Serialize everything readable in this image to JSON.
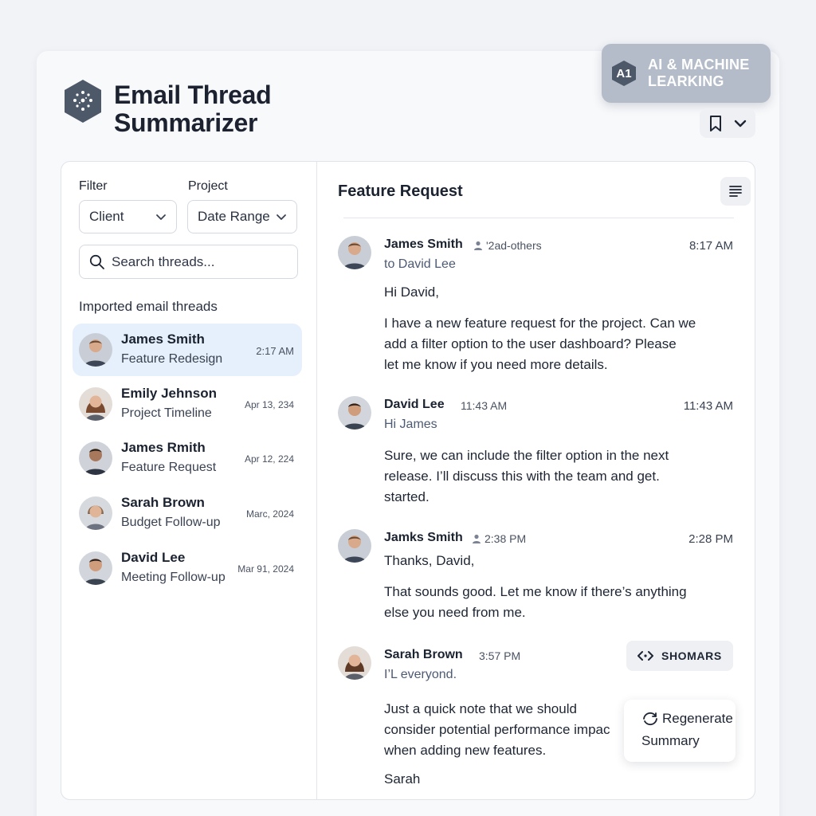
{
  "app": {
    "title": "Email Thread Summarizer"
  },
  "badge": {
    "code": "A1",
    "line1": "AI & MACHINE",
    "line2": "LEARKING"
  },
  "sidebar": {
    "filter_label": "Filter",
    "project_label": "Project",
    "filter_value": "Client",
    "project_value": "Date Range",
    "search_placeholder": "Search threads...",
    "section_title": "Imported email threads",
    "threads": [
      {
        "name": "James Smith",
        "subject": "Feature Redesign",
        "date": "2:17 AM"
      },
      {
        "name": "Emily Jehnson",
        "subject": "Project Timeline",
        "date": "Apr 13, 234"
      },
      {
        "name": "James Rmith",
        "subject": "Feature Request",
        "date": "Apr 12, 224"
      },
      {
        "name": "Sarah Brown",
        "subject": "Budget Follow-up",
        "date": "Marc, 2024"
      },
      {
        "name": "David Lee",
        "subject": "Meeting Follow-up",
        "date": "Mar 91, 2024"
      }
    ]
  },
  "main": {
    "title": "Feature Request",
    "messages": [
      {
        "from": "James Smith",
        "meta": "'2ad-others",
        "time": "8:17 AM",
        "sub": "to David Lee",
        "greeting": "Hi David,",
        "body": [
          "I have a new feature request for the project. Can we",
          "add a filter option to the user dashboard? Please",
          "let me know if you need more details."
        ]
      },
      {
        "from": "David Lee",
        "meta": "11:43 AM",
        "time": "11:43 AM",
        "sub": "Hi James",
        "body": [
          "Sure, we can include the filter option in the next",
          "release. I’ll discuss this with the team and get.",
          "started."
        ]
      },
      {
        "from": "Jamks Smith",
        "meta": "2:38 PM",
        "time": "2:28 PM",
        "greeting": "Thanks, David,",
        "body": [
          "That sounds good. Let me know if there’s anything",
          "else you need from me."
        ]
      },
      {
        "from": "Sarah Brown",
        "meta": "3:57 PM",
        "sub": "I’L everyond.",
        "body": [
          "Just a quick note that we should",
          "consider potential performance impac",
          "when adding new features."
        ],
        "signature": "Sarah"
      }
    ],
    "shomars_label": "SHOMARS",
    "regenerate_line1": "Regenerate",
    "regenerate_line2": "Summary"
  },
  "colors": {
    "accent": "#e6f0fc",
    "badge": "#b3bcc8",
    "logo": "#4d5869"
  },
  "icons": [
    "logo-hex-icon",
    "bookmark-icon",
    "chevron-down-icon",
    "search-icon",
    "list-icon",
    "refresh-icon",
    "person-icon",
    "code-icon",
    "regenerate-icon"
  ]
}
